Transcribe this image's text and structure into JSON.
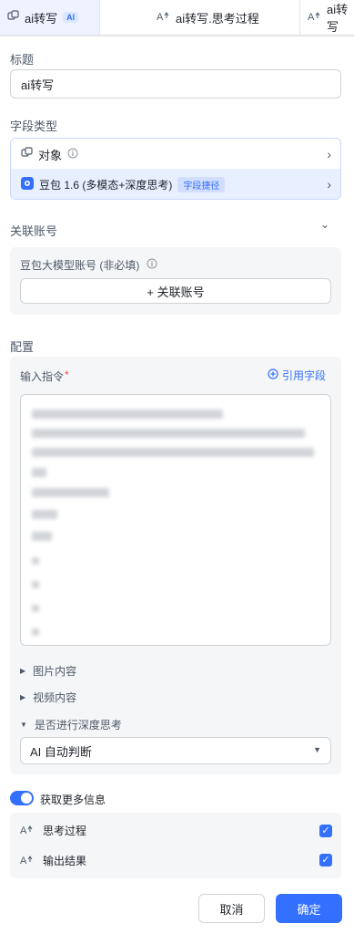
{
  "tabs": [
    {
      "label": "ai转写",
      "badge": "AI",
      "icon": "object-icon"
    },
    {
      "label": "ai转写.思考过程",
      "icon": "ai-text-icon"
    },
    {
      "label": "ai转写",
      "icon": "ai-text-icon"
    }
  ],
  "title_section": {
    "label": "标题",
    "value": "ai转写"
  },
  "field_type": {
    "label": "字段类型",
    "type_name": "对象",
    "model_name": "豆包 1.6 (多模态+深度思考)",
    "model_tag": "字段捷径"
  },
  "linked_account": {
    "label": "关联账号",
    "account_label": "豆包大模型账号 (非必填)",
    "add_button": "+ 关联账号"
  },
  "config": {
    "label": "配置",
    "instruction_label": "输入指令",
    "required_mark": "*",
    "ref_field_label": "引用字段",
    "image_content": "图片内容",
    "video_content": "视频内容",
    "deep_think": "是否进行深度思考",
    "deep_think_value": "AI 自动判断"
  },
  "more_info": {
    "toggle_label": "获取更多信息",
    "options": [
      {
        "label": "思考过程",
        "checked": true
      },
      {
        "label": "输出结果",
        "checked": true
      }
    ]
  },
  "footer": {
    "cancel": "取消",
    "confirm": "确定"
  },
  "colors": {
    "accent": "#3370ff",
    "panel": "#f5f6f7",
    "border": "#d0d3d6"
  }
}
